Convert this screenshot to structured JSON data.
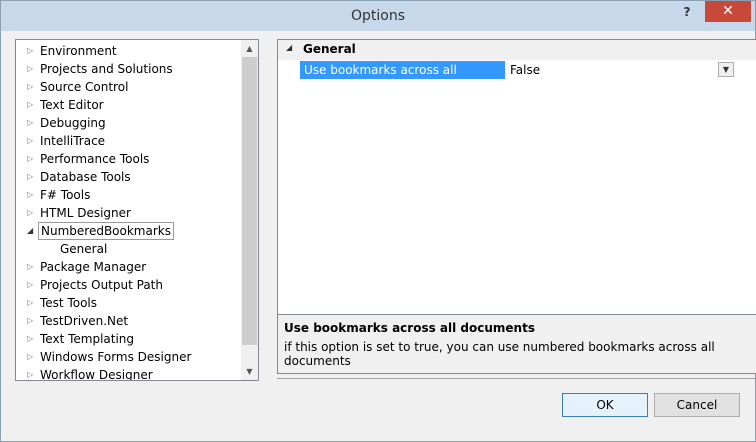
{
  "window": {
    "title": "Options",
    "help_label": "?",
    "close_label": "✕"
  },
  "tree": {
    "items": [
      {
        "label": "Environment"
      },
      {
        "label": "Projects and Solutions"
      },
      {
        "label": "Source Control"
      },
      {
        "label": "Text Editor"
      },
      {
        "label": "Debugging"
      },
      {
        "label": "IntelliTrace"
      },
      {
        "label": "Performance Tools"
      },
      {
        "label": "Database Tools"
      },
      {
        "label": "F# Tools"
      },
      {
        "label": "HTML Designer"
      },
      {
        "label": "NumberedBookmarks"
      },
      {
        "label": "General"
      },
      {
        "label": "Package Manager"
      },
      {
        "label": "Projects Output Path"
      },
      {
        "label": "Test Tools"
      },
      {
        "label": "TestDriven.Net"
      },
      {
        "label": "Text Templating"
      },
      {
        "label": "Windows Forms Designer"
      },
      {
        "label": "Workflow Designer"
      }
    ],
    "collapsed_glyph": "▷",
    "expanded_glyph": "◢"
  },
  "properties": {
    "category": "General",
    "rows": [
      {
        "name": "Use bookmarks across all documents",
        "value": "False"
      }
    ]
  },
  "description": {
    "title": "Use bookmarks across all documents",
    "text": "if this option is set to true, you can use numbered bookmarks across all documents"
  },
  "buttons": {
    "ok": "OK",
    "cancel": "Cancel"
  },
  "colors": {
    "selection": "#3399ff",
    "close": "#c7493a",
    "titlebar": "#c7d8ea"
  }
}
